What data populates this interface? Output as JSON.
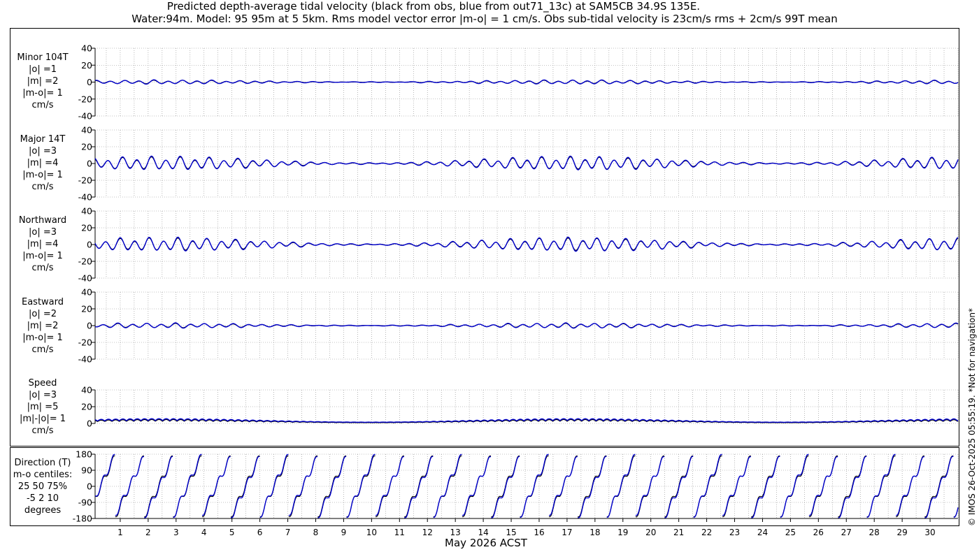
{
  "title_line1": "Predicted depth-average tidal velocity (black from obs, blue from out71_13c) at SAM5CB 34.9S 135E.",
  "title_line2": "Water:94m. Model: 95 95m at 5 5km. Rms model vector error |m-o| = 1 cm/s. Obs sub-tidal velocity is 23cm/s rms + 2cm/s 99T mean",
  "copyright": "© IMOS 26-Oct-2025 05:55:19. *Not for navigation*",
  "colors": {
    "obs": "#000000",
    "model": "#0000cc",
    "grid": "#888888"
  },
  "chart_data": {
    "type": "line",
    "xlabel": "May 2026 ACST",
    "x_ticks": [
      "1",
      "2",
      "3",
      "4",
      "5",
      "6",
      "7",
      "8",
      "9",
      "10",
      "11",
      "12",
      "13",
      "14",
      "15",
      "16",
      "17",
      "18",
      "19",
      "20",
      "21",
      "22",
      "23",
      "24",
      "25",
      "26",
      "27",
      "28",
      "29",
      "30"
    ],
    "xlim_days": [
      0.1,
      31.0
    ],
    "series": [
      {
        "name": "obs",
        "color": "#000000"
      },
      {
        "name": "model",
        "color": "#0000cc"
      }
    ],
    "panels": [
      {
        "id": "minor",
        "label": [
          "Minor 104T",
          "|o| =1",
          "|m| =2",
          "|m-o|= 1",
          "cm/s"
        ],
        "ylim": [
          -40,
          40
        ],
        "yticks": [
          "40",
          "20",
          "0",
          "-20",
          "-40"
        ],
        "amplitude": 2
      },
      {
        "id": "major",
        "label": [
          "Major 14T",
          "|o| =3",
          "|m| =4",
          "|m-o|= 1",
          "cm/s"
        ],
        "ylim": [
          -40,
          40
        ],
        "yticks": [
          "40",
          "20",
          "0",
          "-20",
          "-40"
        ],
        "amplitude": 7
      },
      {
        "id": "north",
        "label": [
          "Northward",
          "|o| =3",
          "|m| =4",
          "|m-o|= 1",
          "cm/s"
        ],
        "ylim": [
          -40,
          40
        ],
        "yticks": [
          "40",
          "20",
          "0",
          "-20",
          "-40"
        ],
        "amplitude": 7
      },
      {
        "id": "east",
        "label": [
          "Eastward",
          "|o| =2",
          "|m| =2",
          "|m-o|= 1",
          "cm/s"
        ],
        "ylim": [
          -40,
          40
        ],
        "yticks": [
          "40",
          "20",
          "0",
          "-20",
          "-40"
        ],
        "amplitude": 2.5
      },
      {
        "id": "speed",
        "label": [
          "Speed",
          "|o| =3",
          "|m| =5",
          "|m|-|o|= 1",
          "cm/s"
        ],
        "ylim": [
          0,
          40
        ],
        "yticks": [
          "40",
          "20",
          "0"
        ],
        "amplitude": 4
      },
      {
        "id": "direction",
        "label": [
          "Direction (T)",
          "m-o centiles:",
          "25  50  75%",
          "-5   2  10",
          "degrees"
        ],
        "ylim": [
          -180,
          180
        ],
        "yticks": [
          "180",
          "90",
          "0",
          "-90",
          "-180"
        ],
        "amplitude": 180
      }
    ]
  }
}
